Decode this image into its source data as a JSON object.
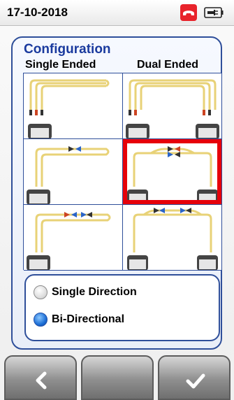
{
  "status": {
    "date": "17-10-2018",
    "phone_icon": "phone-hangup-icon",
    "battery_icon": "battery-plug-icon",
    "phone_color": "#e8232b"
  },
  "config": {
    "title": "Configuration",
    "col_single": "Single Ended",
    "col_dual": "Dual Ended",
    "selected_cell": "dual-ended-row-2",
    "highlight_color": "#e6000a"
  },
  "direction": {
    "options": [
      {
        "label": "Single Direction",
        "selected": false
      },
      {
        "label": "Bi-Directional",
        "selected": true
      }
    ]
  },
  "softkeys": [
    {
      "icon": "chevron-left-icon"
    },
    {
      "icon": ""
    },
    {
      "icon": "checkmark-icon"
    }
  ]
}
